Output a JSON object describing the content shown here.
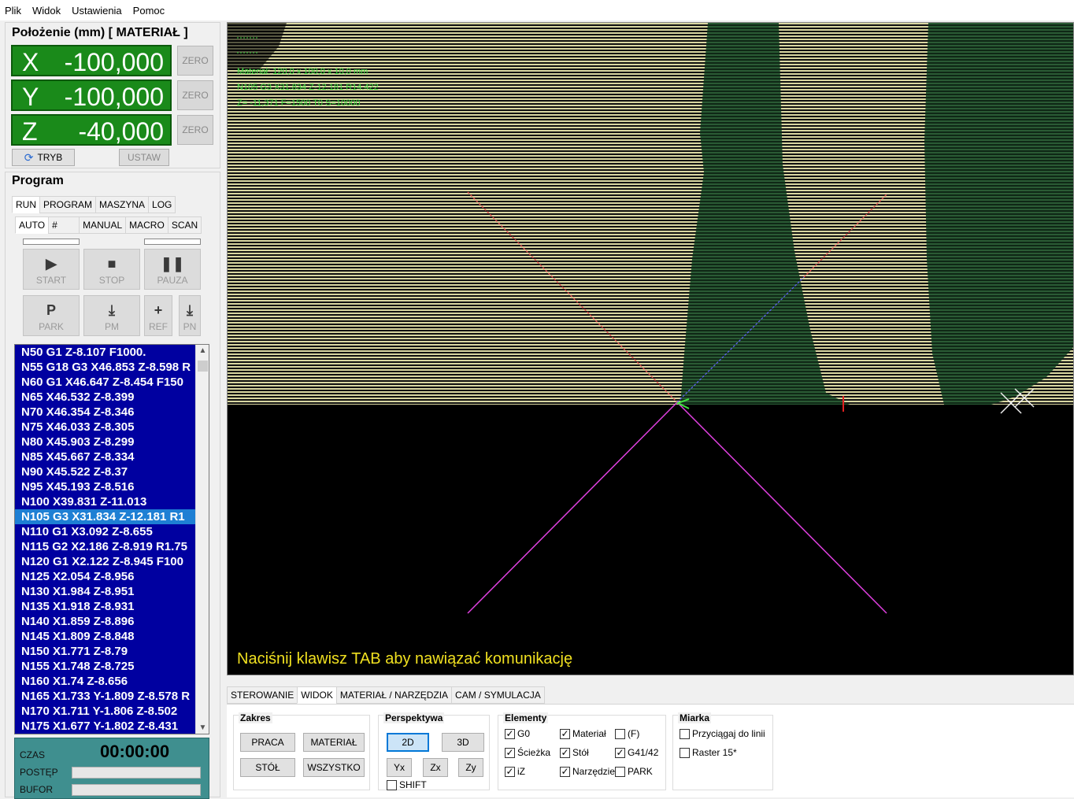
{
  "menu": [
    "Plik",
    "Widok",
    "Ustawienia",
    "Pomoc"
  ],
  "position": {
    "title": "Położenie (mm) [ MATERIAŁ ]",
    "axes": [
      {
        "label": "X",
        "value": "-100,000",
        "zero": "ZERO"
      },
      {
        "label": "Y",
        "value": "-100,000",
        "zero": "ZERO"
      },
      {
        "label": "Z",
        "value": "-40,000",
        "zero": "ZERO"
      }
    ],
    "mode_button": "TRYB",
    "set_button": "USTAW"
  },
  "program": {
    "title": "Program",
    "tabs": [
      "RUN",
      "PROGRAM",
      "MASZYNA",
      "LOG"
    ],
    "subtabs": [
      "AUTO",
      "#",
      "MANUAL",
      "MACRO",
      "SCAN"
    ],
    "buttons": {
      "start": "START",
      "stop": "STOP",
      "pause": "PAUZA",
      "park": "PARK",
      "pm": "PM",
      "ref": "REF",
      "pn": "PN"
    },
    "code_lines": [
      "N50  G1 Z-8.107 F1000.",
      "N55  G18 G3 X46.853 Z-8.598 R",
      "N60  G1 X46.647 Z-8.454 F150",
      "N65  X46.532 Z-8.399",
      "N70  X46.354 Z-8.346",
      "N75  X46.033 Z-8.305",
      "N80  X45.903 Z-8.299",
      "N85  X45.667 Z-8.334",
      "N90  X45.522 Z-8.37",
      "N95  X45.193 Z-8.516",
      "N100  X39.831 Z-11.013",
      "N105  G3 X31.834 Z-12.181 R1",
      "N110  G1 X3.092 Z-8.655",
      "N115  G2 X2.186 Z-8.919 R1.75",
      "N120  G1 X2.122 Z-8.945 F100",
      "N125  X2.054 Z-8.956",
      "N130  X1.984 Z-8.951",
      "N135  X1.918 Z-8.931",
      "N140  X1.859 Z-8.896",
      "N145  X1.809 Z-8.848",
      "N150  X1.771 Z-8.79",
      "N155  X1.748 Z-8.725",
      "N160  X1.74 Z-8.656",
      "N165  X1.733 Y-1.809 Z-8.578 R",
      "N170  X1.711 Y-1.806 Z-8.502",
      "N175  X1.677 Y-1.802 Z-8.431"
    ],
    "status": {
      "time_label": "CZAS",
      "time_value": "00:00:00",
      "progress_label": "POSTĘP",
      "buffer_label": "BUFOR"
    }
  },
  "viewport": {
    "overlay_lines": [
      "Materiał: 120,0 x 100,0 x 10,0 mm",
      "N105  G3 X31.834 Z-12.181 R14.422",
      "Z= -11,371  F=1500  T0  S=10000"
    ],
    "message": "Naciśnij klawisz TAB aby nawiązać komunikację",
    "colors": {
      "stock": "#d8d6a0",
      "cut": "#1f4a2c",
      "axis": "#e040e0",
      "overlay_text": "#3fdc3f",
      "message": "#f0e020"
    }
  },
  "bottom": {
    "tabs": [
      "STEROWANIE",
      "WIDOK",
      "MATERIAŁ / NARZĘDZIA",
      "CAM / SYMULACJA"
    ],
    "active_tab": "WIDOK",
    "zakres": {
      "title": "Zakres",
      "buttons": [
        "PRACA",
        "MATERIAŁ",
        "STÓŁ",
        "WSZYSTKO"
      ]
    },
    "perspektywa": {
      "title": "Perspektywa",
      "buttons": [
        "2D",
        "3D",
        "Yx",
        "Zx",
        "Zy"
      ],
      "shift": "SHIFT"
    },
    "elementy": {
      "title": "Elementy",
      "items": [
        {
          "label": "G0",
          "checked": true
        },
        {
          "label": "Materiał",
          "checked": true
        },
        {
          "label": "(F)",
          "checked": false
        },
        {
          "label": "Ścieżka",
          "checked": true
        },
        {
          "label": "Stół",
          "checked": true
        },
        {
          "label": "G41/42",
          "checked": true
        },
        {
          "label": "iZ",
          "checked": true
        },
        {
          "label": "Narzędzie",
          "checked": true
        },
        {
          "label": "PARK",
          "checked": false
        }
      ]
    },
    "miarka": {
      "title": "Miarka",
      "items": [
        {
          "label": "Przyciągaj do linii",
          "checked": false
        },
        {
          "label": "Raster 15*",
          "checked": false
        }
      ]
    }
  }
}
